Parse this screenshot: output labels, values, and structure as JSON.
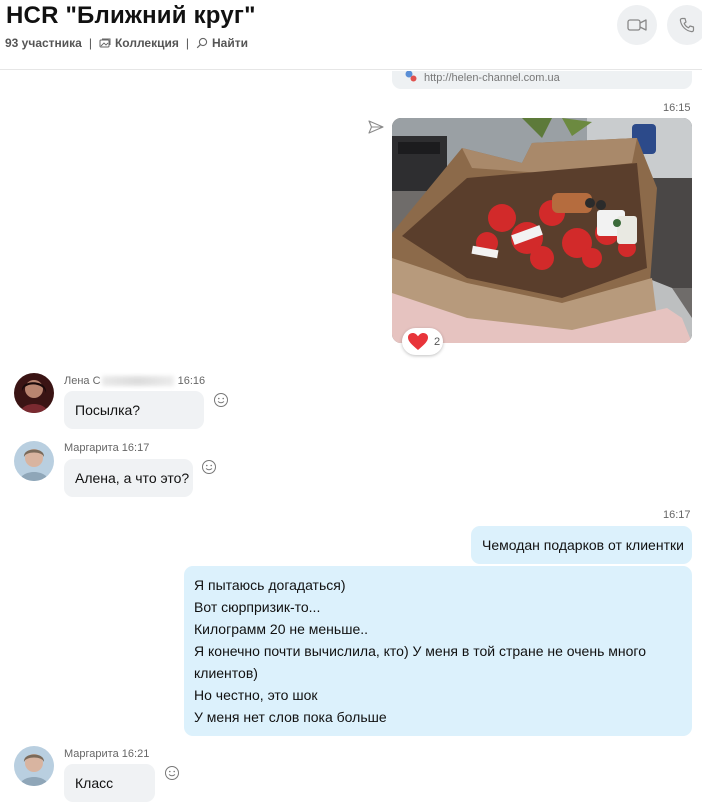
{
  "header": {
    "title": "HCR \"Ближний круг\"",
    "members": "93 участника",
    "separator": "|",
    "gallery_label": "Коллекция",
    "search_label": "Найти"
  },
  "messages": {
    "link_url": "http://helen-channel.com.ua",
    "photo_time": "16:15",
    "photo_reaction_count": "2",
    "lena": {
      "name": "Лена С",
      "time": "16:16",
      "text": "Посылка?"
    },
    "margarita1": {
      "name": "Маргарита",
      "time": "16:17",
      "text": "Алена, а что это?"
    },
    "out1": {
      "time": "16:17",
      "text": "Чемодан подарков от клиентки"
    },
    "out2": {
      "lines": [
        "Я пытаюсь догадаться)",
        "Вот сюрпризик-то...",
        "Килограмм 20 не меньше..",
        "Я конечно почти вычислила, кто) У меня в той стране не очень много",
        "клиентов)",
        "Но честно, это шок",
        "У меня нет слов пока больше"
      ]
    },
    "margarita2": {
      "name": "Маргарита",
      "time": "16:21",
      "text": "Класс"
    }
  },
  "colors": {
    "incoming_bubble": "#f0f2f4",
    "outgoing_bubble": "#dcf1fc",
    "heart": "#e8343a"
  }
}
